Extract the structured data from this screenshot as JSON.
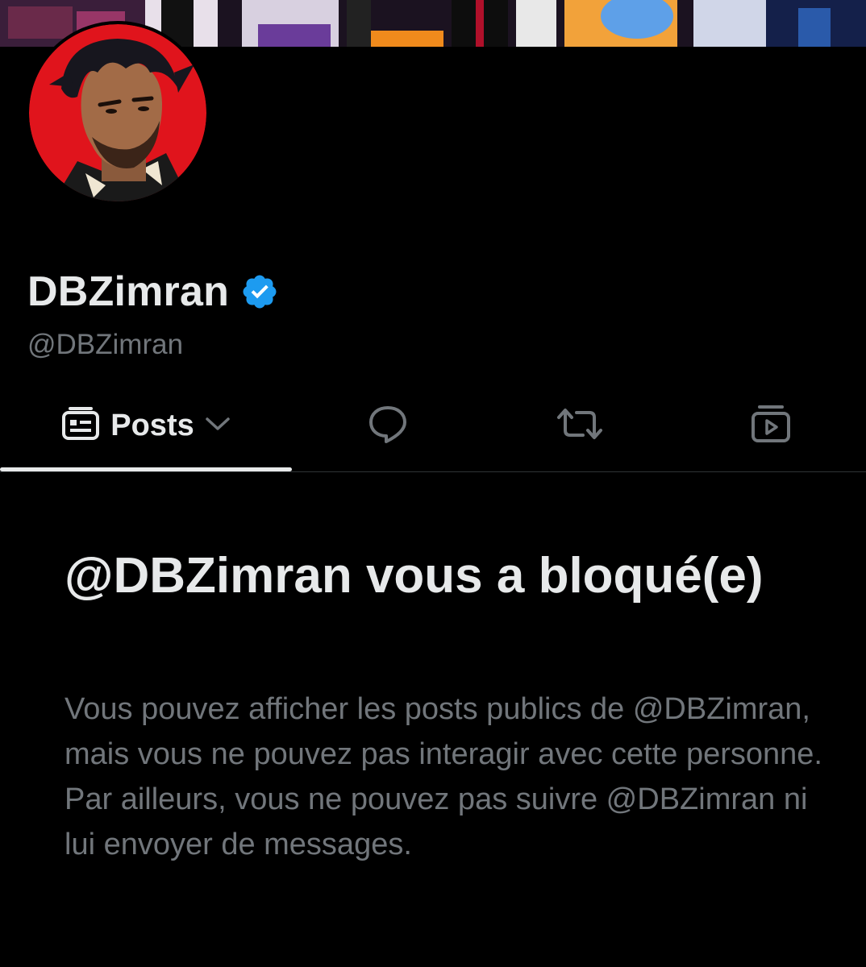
{
  "profile": {
    "display_name": "DBZimran",
    "handle": "@DBZimran",
    "verified_icon": "verified-badge-icon",
    "accent_color": "#1d9bf0"
  },
  "tabs": [
    {
      "label": "Posts",
      "icon": "posts-feed-icon",
      "dropdown_icon": "chevron-down-icon",
      "active": true
    },
    {
      "label": "",
      "icon": "reply-bubble-icon",
      "active": false
    },
    {
      "label": "",
      "icon": "repost-icon",
      "active": false
    },
    {
      "label": "",
      "icon": "media-play-icon",
      "active": false
    }
  ],
  "blocked": {
    "title": "@DBZimran vous a bloqué(e)",
    "description": "Vous pouvez afficher les posts publics de @DBZimran, mais vous ne pouvez pas interagir avec cette personne. Par ailleurs, vous ne pouvez pas suivre @DBZimran ni lui envoyer de messages."
  },
  "colors": {
    "background": "#000000",
    "primary_text": "#e7e9ea",
    "secondary_text": "#71767b",
    "divider": "#2f3336"
  }
}
